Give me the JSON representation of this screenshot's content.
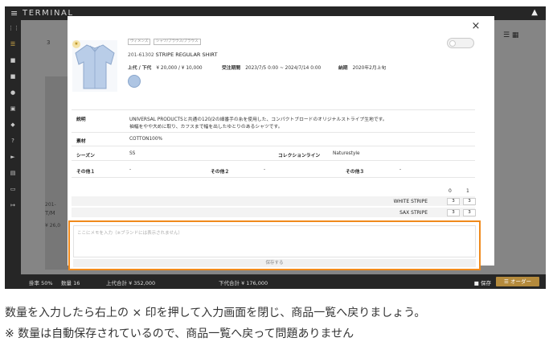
{
  "app": {
    "title": "TERMINAL"
  },
  "background": {
    "counter": "3",
    "card_code": "201-",
    "card_name": "T/M",
    "card_price": "¥ 26,0"
  },
  "status_bar": {
    "rate": "掛率 50%",
    "qty": "数量 16",
    "upper_total": "上代合計 ¥ 352,000",
    "lower_total": "下代合計 ¥ 176,000",
    "save": "保存",
    "order": "オーダー"
  },
  "modal": {
    "close_label": "×",
    "tags": [
      "ウィメンズ",
      "シャツ/ブラウス/ブラウス"
    ],
    "product_code": "201-61302",
    "product_name": "STRIPE REGULAR SHIRT",
    "price_label": "上代 / 下代",
    "price_value": "¥ 20,000 / ¥ 10,000",
    "order_period_label": "受注期間",
    "order_period_value": "2023/7/5 0:00 ~ 2024/7/14 0:00",
    "delivery_label": "納期",
    "delivery_value": "2020年2月上旬",
    "details": {
      "description_label": "説明",
      "description_line1": "UNIVERSAL PRODUCTSと共通の120/2の細番手の糸を使用した、コンパクトブロードのオリジナルストライプ生地です。",
      "description_line2": "袖幅をやや大めに取り、カフスまで幅を出したゆとりのあるシャツです。",
      "material_label": "素材",
      "material_value": "COTTON100%",
      "season_label": "シーズン",
      "season_value": "SS",
      "collection_label": "コレクションライン",
      "collection_value": "Naturestyle",
      "other1_label": "その他１",
      "other1_value": "-",
      "other2_label": "その他２",
      "other2_value": "-",
      "other3_label": "その他３",
      "other3_value": "-"
    },
    "quantity": {
      "sizes": [
        "0",
        "1"
      ],
      "rows": [
        {
          "color": "WHITE STRIPE",
          "values": [
            "3",
            "3"
          ]
        },
        {
          "color": "SAX STRIPE",
          "values": [
            "3",
            "3"
          ]
        }
      ]
    },
    "memo_placeholder": "ここにメモを入力（※ブランドには表示されません）",
    "memo_save": "保存する"
  },
  "captions": {
    "line1": "数量を入力したら右上の × 印を押して入力画面を閉じ、商品一覧へ戻りましょう。",
    "line2": "※ 数量は自動保存されているので、商品一覧へ戻って問題ありません"
  },
  "colors": {
    "highlight": "#f08a1c",
    "accent": "#b48a3c",
    "bar": "#262626"
  }
}
